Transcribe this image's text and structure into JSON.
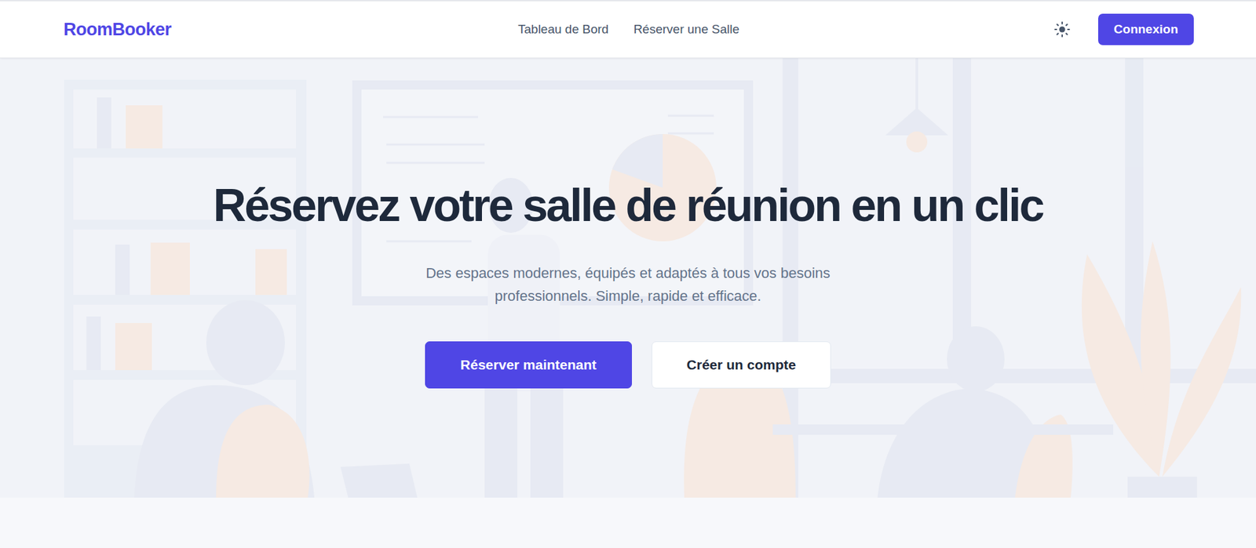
{
  "header": {
    "logo": "RoomBooker",
    "nav": [
      {
        "label": "Tableau de Bord",
        "selected": false
      },
      {
        "label": "Réserver une Salle",
        "selected": false
      }
    ],
    "login_button": "Connexion"
  },
  "hero": {
    "title": "Réservez votre salle de réunion en un clic",
    "subtitle": "Des espaces modernes, équipés et adaptés à tous vos besoins professionnels. Simple, rapide et efficace.",
    "buttons": [
      {
        "label": "Réserver maintenant",
        "kind": "primary"
      },
      {
        "label": "Créer un compte",
        "kind": "secondary"
      }
    ]
  }
}
